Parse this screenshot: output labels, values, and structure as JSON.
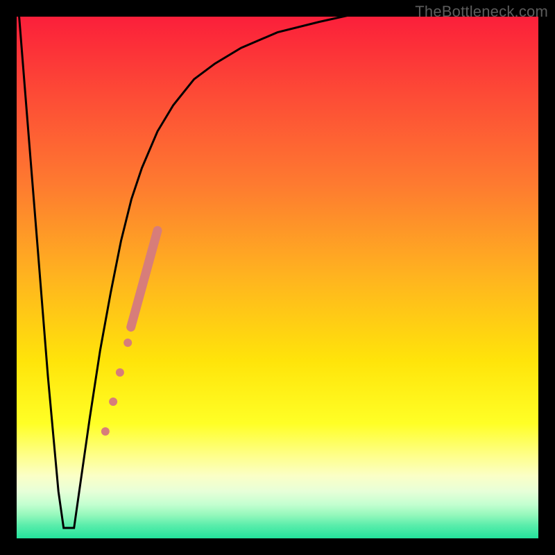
{
  "watermark": "TheBottleneck.com",
  "colors": {
    "frame": "#000000",
    "curve": "#000000",
    "markers": "#d77d7a",
    "gradient_stops": [
      {
        "y": 0.0,
        "c": "#fb1f3a"
      },
      {
        "y": 0.15,
        "c": "#fd4b36"
      },
      {
        "y": 0.32,
        "c": "#fe7a30"
      },
      {
        "y": 0.5,
        "c": "#ffb41f"
      },
      {
        "y": 0.66,
        "c": "#ffe40a"
      },
      {
        "y": 0.78,
        "c": "#ffff26"
      },
      {
        "y": 0.84,
        "c": "#feff88"
      },
      {
        "y": 0.88,
        "c": "#fbffc6"
      },
      {
        "y": 0.91,
        "c": "#e7ffd8"
      },
      {
        "y": 0.935,
        "c": "#c3ffd0"
      },
      {
        "y": 0.955,
        "c": "#95f8bc"
      },
      {
        "y": 0.975,
        "c": "#5aedab"
      },
      {
        "y": 1.0,
        "c": "#23e39c"
      }
    ]
  },
  "chart_data": {
    "type": "line",
    "title": "",
    "xlabel": "",
    "ylabel": "",
    "xlim": [
      0,
      100
    ],
    "ylim": [
      0,
      100
    ],
    "series": [
      {
        "name": "bottleneck-curve",
        "x": [
          0,
          2,
          4,
          6,
          8,
          9,
          10,
          11,
          12,
          14,
          16,
          18,
          20,
          22,
          24,
          27,
          30,
          34,
          38,
          43,
          50,
          58,
          67,
          78,
          90,
          100
        ],
        "y": [
          106,
          81,
          56,
          31,
          9,
          2,
          2,
          2,
          9,
          23,
          36,
          47,
          57,
          65,
          71,
          78,
          83,
          88,
          91,
          94,
          97,
          99,
          101,
          103,
          104,
          105
        ]
      }
    ],
    "markers": {
      "name": "highlight-dots",
      "points": [
        {
          "x": 17.0,
          "y": 20.5,
          "r": 6
        },
        {
          "x": 18.5,
          "y": 26.2,
          "r": 6
        },
        {
          "x": 19.8,
          "y": 31.8,
          "r": 6
        },
        {
          "x": 21.3,
          "y": 37.5,
          "r": 6
        }
      ],
      "band": {
        "x1": 21.9,
        "x2": 27.0,
        "y1": 40.5,
        "y2": 59.0,
        "width": 13
      }
    }
  }
}
